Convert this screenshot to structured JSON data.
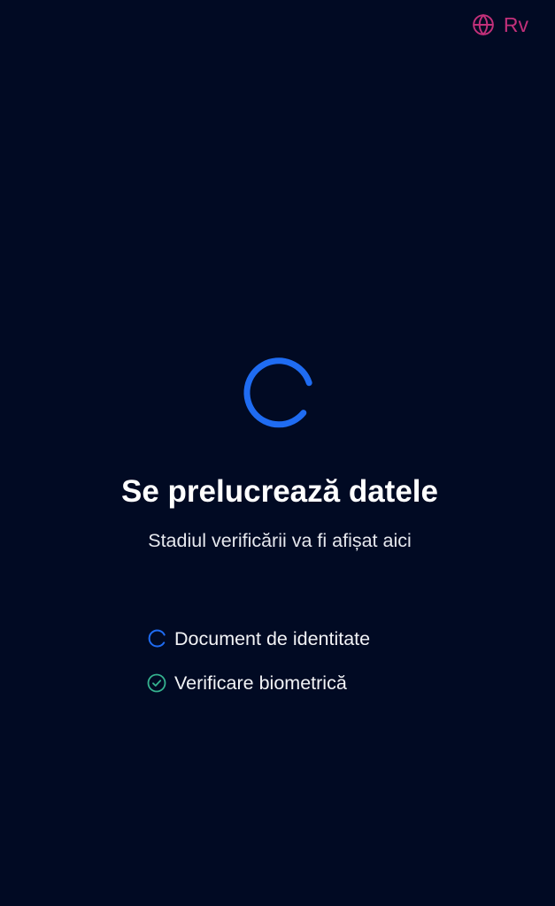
{
  "header": {
    "language_label": "Rv",
    "language_icon": "globe-icon"
  },
  "status": {
    "title": "Se prelucrează datele",
    "subtitle": "Stadiul verificării va fi afișat aici",
    "spinner_icon": "loading-spinner-icon"
  },
  "steps": [
    {
      "label": "Document de identitate",
      "state": "in-progress",
      "icon": "loading-spinner-icon"
    },
    {
      "label": "Verificare biometrică",
      "state": "completed",
      "icon": "check-circle-icon"
    }
  ],
  "colors": {
    "background": "#010a23",
    "accent_blue": "#1f6cf2",
    "language_pink": "#c2307a",
    "success_green": "#35b28f",
    "text_white": "#ffffff"
  }
}
